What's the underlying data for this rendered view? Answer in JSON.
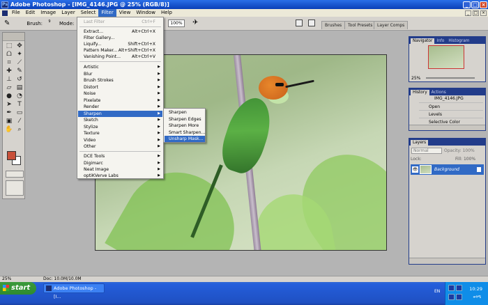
{
  "window": {
    "title": "Adobe Photoshop - [IMG_4146.JPG @ 25% (RGB/8)]",
    "ps_badge": "Ps",
    "controls": [
      "_",
      "□",
      "×"
    ]
  },
  "menubar": {
    "items": [
      "File",
      "Edit",
      "Image",
      "Layer",
      "Select",
      "Filter",
      "View",
      "Window",
      "Help"
    ],
    "active": "Filter",
    "doc_controls": [
      "_",
      "□",
      "×"
    ]
  },
  "options_bar": {
    "brush_label": "Brush:",
    "brush_size": "9",
    "mode_label": "Mode:",
    "zoom_value": "100%"
  },
  "palette_well": {
    "tabs": [
      "Brushes",
      "Tool Presets",
      "Layer Comps"
    ]
  },
  "filter_menu": {
    "last_filter": {
      "label": "Last Filter",
      "shortcut": "Ctrl+F"
    },
    "group1": [
      {
        "label": "Extract...",
        "shortcut": "Alt+Ctrl+X"
      },
      {
        "label": "Filter Gallery...",
        "shortcut": ""
      },
      {
        "label": "Liquify...",
        "shortcut": "Shift+Ctrl+X"
      },
      {
        "label": "Pattern Maker...",
        "shortcut": "Alt+Shift+Ctrl+X"
      },
      {
        "label": "Vanishing Point...",
        "shortcut": "Alt+Ctrl+V"
      }
    ],
    "group2": [
      "Artistic",
      "Blur",
      "Brush Strokes",
      "Distort",
      "Noise",
      "Pixelate",
      "Render",
      "Sharpen",
      "Sketch",
      "Stylize",
      "Texture",
      "Video",
      "Other"
    ],
    "highlighted": "Sharpen",
    "group3": [
      "DCE Tools",
      "Digimarc",
      "Neat Image",
      "optiKVerve Labs"
    ]
  },
  "sharpen_submenu": {
    "items": [
      "Sharpen",
      "Sharpen Edges",
      "Sharpen More",
      "Smart Sharpen...",
      "Unsharp Mask..."
    ],
    "highlighted": "Unsharp Mask..."
  },
  "navigator": {
    "tabs": [
      "Navigator",
      "Info",
      "Histogram"
    ],
    "zoom": "25%"
  },
  "history": {
    "tabs": [
      "History",
      "Actions"
    ],
    "snapshot": "IMG_4146.JPG",
    "states": [
      "Open",
      "Levels",
      "Selective Color"
    ]
  },
  "layers": {
    "tabs": [
      "Layers"
    ],
    "blend_mode": "Normal",
    "opacity_label": "Opacity:",
    "opacity_value": "100%",
    "lock_label": "Lock:",
    "fill_label": "Fill:",
    "fill_value": "100%",
    "layer_name": "Background"
  },
  "status_bar": {
    "zoom": "25%",
    "doc_size": "Doc: 10.0M/10.0M"
  },
  "taskbar": {
    "start_label": "start",
    "task_item": "Adobe Photoshop - [I...",
    "language": "EN",
    "clock": "10:29",
    "day_text": "ቅዳሜ"
  }
}
